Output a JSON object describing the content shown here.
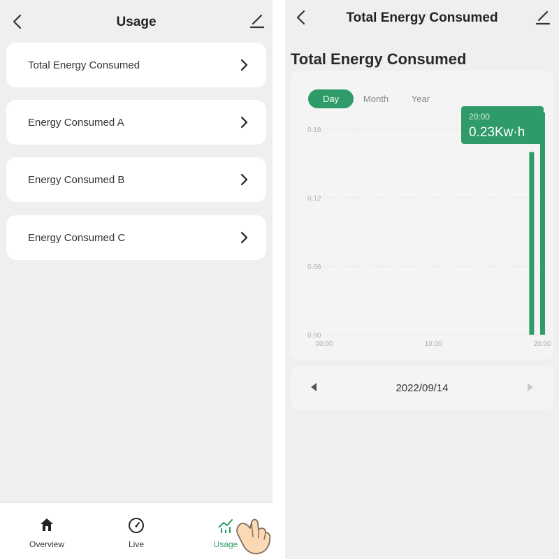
{
  "usage_screen": {
    "title": "Usage",
    "items": [
      {
        "label": "Total Energy Consumed"
      },
      {
        "label": "Energy Consumed A"
      },
      {
        "label": "Energy Consumed B"
      },
      {
        "label": "Energy Consumed C"
      }
    ],
    "tabs": [
      {
        "label": "Overview",
        "icon": "home-icon"
      },
      {
        "label": "Live",
        "icon": "gauge-icon"
      },
      {
        "label": "Usage",
        "icon": "usage-chart-icon",
        "active": true
      }
    ]
  },
  "detail_screen": {
    "header_title": "Total Energy Consumed",
    "page_title": "Total Energy Consumed",
    "periods": [
      {
        "label": "Day",
        "active": true
      },
      {
        "label": "Month"
      },
      {
        "label": "Year"
      }
    ],
    "tooltip": {
      "time": "20:00",
      "value": "0.23Kw·h"
    },
    "date": "2022/09/14"
  },
  "colors": {
    "accent": "#2e9b68",
    "background": "#efefef",
    "card": "#ffffff",
    "chart_card": "#f4f4f4"
  },
  "chart_data": {
    "type": "bar",
    "x_tick_labels": [
      "00:00",
      "10:00",
      "20:00"
    ],
    "y_tick_labels": [
      "0.00",
      "0.06",
      "0.12",
      "0.18"
    ],
    "ylim": [
      0,
      0.18
    ],
    "grid": true,
    "bars": [
      {
        "x": "19:00",
        "value": 0.16
      },
      {
        "x": "20:00",
        "value": 0.23
      }
    ],
    "highlighted": "20:00"
  }
}
